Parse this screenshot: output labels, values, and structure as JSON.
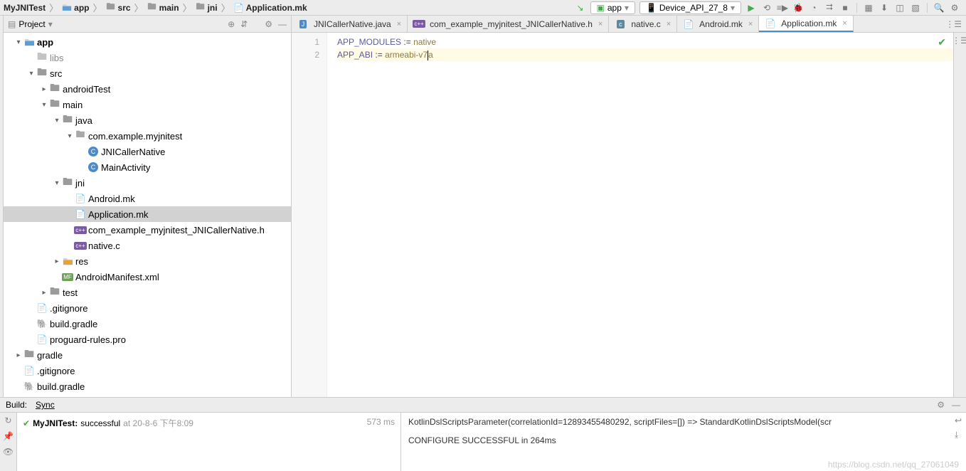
{
  "breadcrumb": {
    "items": [
      {
        "label": "MyJNITest",
        "icon": "project"
      },
      {
        "label": "app",
        "icon": "module"
      },
      {
        "label": "src",
        "icon": "folder"
      },
      {
        "label": "main",
        "icon": "folder"
      },
      {
        "label": "jni",
        "icon": "folder"
      },
      {
        "label": "Application.mk",
        "icon": "mk"
      }
    ]
  },
  "runConfigs": {
    "app": "app",
    "device": "Device_API_27_8"
  },
  "projectPanel": {
    "title": "Project",
    "tree": [
      {
        "depth": 0,
        "arrow": "down",
        "icon": "module",
        "label": "app",
        "bold": true
      },
      {
        "depth": 1,
        "arrow": "none",
        "icon": "folder-grey",
        "label": "libs",
        "grey": true
      },
      {
        "depth": 1,
        "arrow": "down",
        "icon": "folder",
        "label": "src"
      },
      {
        "depth": 2,
        "arrow": "right",
        "icon": "folder",
        "label": "androidTest"
      },
      {
        "depth": 2,
        "arrow": "down",
        "icon": "folder",
        "label": "main"
      },
      {
        "depth": 3,
        "arrow": "down",
        "icon": "folder",
        "label": "java"
      },
      {
        "depth": 4,
        "arrow": "down",
        "icon": "package",
        "label": "com.example.myjnitest"
      },
      {
        "depth": 5,
        "arrow": "none",
        "icon": "class",
        "label": "JNICallerNative"
      },
      {
        "depth": 5,
        "arrow": "none",
        "icon": "class",
        "label": "MainActivity"
      },
      {
        "depth": 3,
        "arrow": "down",
        "icon": "folder",
        "label": "jni"
      },
      {
        "depth": 4,
        "arrow": "none",
        "icon": "mk",
        "label": "Android.mk"
      },
      {
        "depth": 4,
        "arrow": "none",
        "icon": "mk",
        "label": "Application.mk",
        "selected": true
      },
      {
        "depth": 4,
        "arrow": "none",
        "icon": "cpp",
        "label": "com_example_myjnitest_JNICallerNative.h"
      },
      {
        "depth": 4,
        "arrow": "none",
        "icon": "cpp",
        "label": "native.c"
      },
      {
        "depth": 3,
        "arrow": "right",
        "icon": "folder-res",
        "label": "res"
      },
      {
        "depth": 3,
        "arrow": "none",
        "icon": "manifest",
        "label": "AndroidManifest.xml"
      },
      {
        "depth": 2,
        "arrow": "right",
        "icon": "folder",
        "label": "test"
      },
      {
        "depth": 1,
        "arrow": "none",
        "icon": "gitignore",
        "label": ".gitignore"
      },
      {
        "depth": 1,
        "arrow": "none",
        "icon": "gradle",
        "label": "build.gradle"
      },
      {
        "depth": 1,
        "arrow": "none",
        "icon": "file",
        "label": "proguard-rules.pro"
      },
      {
        "depth": 0,
        "arrow": "right",
        "icon": "folder",
        "label": "gradle"
      },
      {
        "depth": 0,
        "arrow": "none",
        "icon": "gitignore",
        "label": ".gitignore"
      },
      {
        "depth": 0,
        "arrow": "none",
        "icon": "gradle",
        "label": "build.gradle"
      }
    ]
  },
  "editor": {
    "tabs": [
      {
        "icon": "java",
        "label": "JNICallerNative.java"
      },
      {
        "icon": "cpp",
        "label": "com_example_myjnitest_JNICallerNative.h"
      },
      {
        "icon": "c",
        "label": "native.c"
      },
      {
        "icon": "mk",
        "label": "Android.mk"
      },
      {
        "icon": "mk",
        "label": "Application.mk",
        "active": true
      }
    ],
    "lines": [
      {
        "n": "1",
        "text": "APP_MODULES := native"
      },
      {
        "n": "2",
        "text": "APP_ABI := armeabi-v7a",
        "current": true
      }
    ]
  },
  "build": {
    "title": "Build:",
    "tab": "Sync",
    "project": "MyJNITest:",
    "status": "successful",
    "timestamp": "at 20-8-6 下午8:09",
    "duration": "573 ms",
    "console1": "KotlinDslScriptsParameter(correlationId=12893455480292, scriptFiles=[]) => StandardKotlinDslScriptsModel(scr",
    "console2": "CONFIGURE SUCCESSFUL in 264ms"
  },
  "watermark": "https://blog.csdn.net/qq_27061049"
}
